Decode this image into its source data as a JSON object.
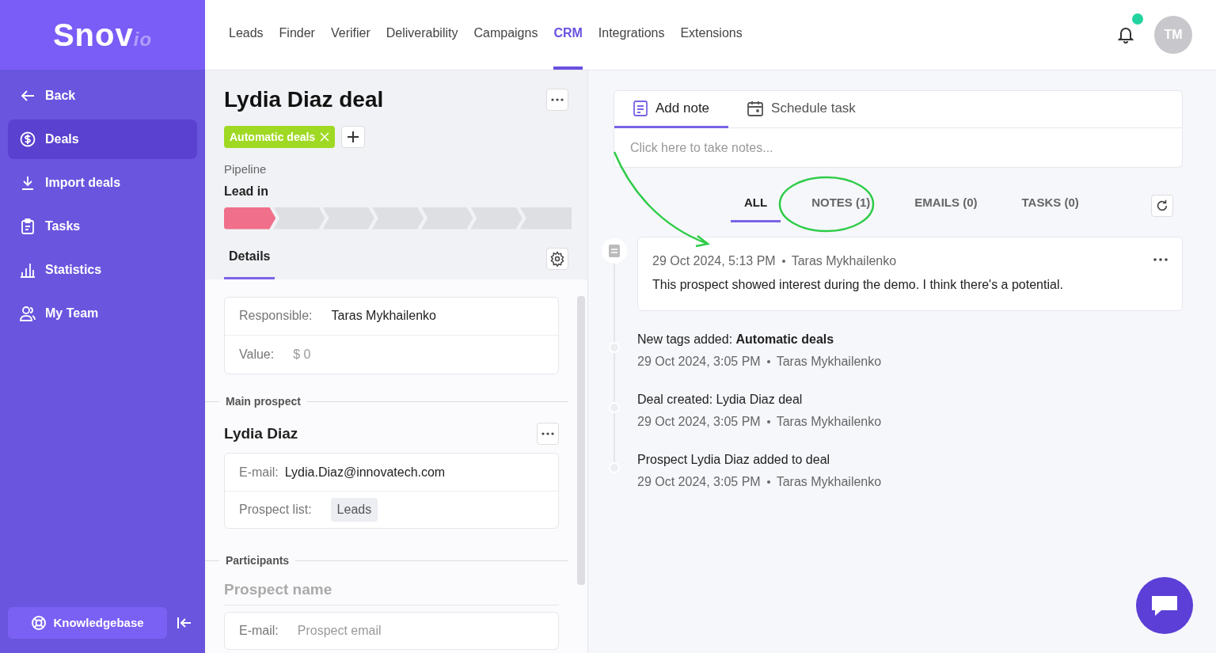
{
  "logo": {
    "main": "Snov",
    "suffix": "io"
  },
  "sidebar": {
    "items": [
      {
        "label": "Back",
        "selected": false
      },
      {
        "label": "Deals",
        "selected": true
      },
      {
        "label": "Import deals",
        "selected": false
      },
      {
        "label": "Tasks",
        "selected": false
      },
      {
        "label": "Statistics",
        "selected": false
      },
      {
        "label": "My Team",
        "selected": false
      }
    ],
    "knowledgebase": "Knowledgebase"
  },
  "top_nav": {
    "items": [
      {
        "label": "Leads",
        "selected": false
      },
      {
        "label": "Finder",
        "selected": false
      },
      {
        "label": "Verifier",
        "selected": false
      },
      {
        "label": "Deliverability",
        "selected": false
      },
      {
        "label": "Campaigns",
        "selected": false
      },
      {
        "label": "CRM",
        "selected": true
      },
      {
        "label": "Integrations",
        "selected": false
      },
      {
        "label": "Extensions",
        "selected": false
      }
    ],
    "notification_dot": true,
    "avatar": "TM"
  },
  "deal": {
    "title": "Lydia Diaz deal",
    "tags": [
      "Automatic deals"
    ],
    "pipeline_label": "Pipeline",
    "stage": "Lead in",
    "stages": [
      {
        "reached": true
      },
      {
        "reached": false
      },
      {
        "reached": false
      },
      {
        "reached": false
      },
      {
        "reached": false
      },
      {
        "reached": false
      },
      {
        "reached": false
      }
    ],
    "tabs": [
      {
        "label": "Details",
        "selected": true
      }
    ],
    "details": [
      {
        "label": "Responsible:",
        "value": "Taras Mykhailenko",
        "muted": false
      },
      {
        "label": "Value:",
        "value": "$ 0",
        "muted": true
      }
    ],
    "main_prospect": {
      "heading": "Main prospect",
      "name": "Lydia Diaz",
      "email_label": "E-mail:",
      "email": "Lydia.Diaz@innovatech.com",
      "list_label": "Prospect list:",
      "list": "Leads"
    },
    "participants": {
      "heading": "Participants",
      "name_placeholder": "Prospect name",
      "email_label": "E-mail:",
      "email_placeholder": "Prospect email"
    }
  },
  "composer": {
    "tabs": [
      {
        "label": "Add note",
        "selected": true
      },
      {
        "label": "Schedule task",
        "selected": false
      }
    ],
    "placeholder": "Click here to take notes..."
  },
  "activity_tabs": [
    {
      "label": "ALL",
      "selected": true
    },
    {
      "label": "NOTES (1)",
      "selected": false
    },
    {
      "label": "EMAILS (0)",
      "selected": false
    },
    {
      "label": "TASKS (0)",
      "selected": false
    }
  ],
  "activity": [
    {
      "kind": "note",
      "date": "29 Oct 2024, 5:13 PM",
      "author": "Taras Mykhailenko",
      "text": "This prospect showed interest during the demo. I think there's a potential."
    },
    {
      "kind": "event",
      "text": "New tags added: **Automatic deals**",
      "date": "29 Oct 2024, 3:05 PM",
      "author": "Taras Mykhailenko"
    },
    {
      "kind": "event",
      "text": "Deal created: Lydia Diaz deal",
      "date": "29 Oct 2024, 3:05 PM",
      "author": "Taras Mykhailenko"
    },
    {
      "kind": "event",
      "text": "Prospect Lydia Diaz added to deal",
      "date": "29 Oct 2024, 3:05 PM",
      "author": "Taras Mykhailenko"
    }
  ]
}
